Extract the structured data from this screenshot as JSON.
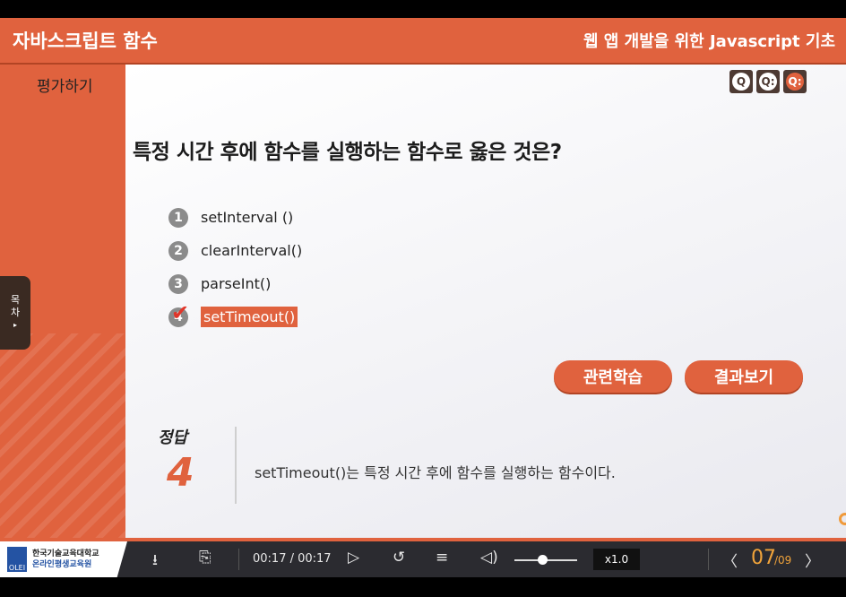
{
  "header": {
    "title": "자바스크립트 함수",
    "subtitle": "웹 앱 개발을 위한 Javascript 기초"
  },
  "sidebar": {
    "section_label": "평가하기",
    "toc_label_1": "목",
    "toc_label_2": "차",
    "toc_arrow": "▸"
  },
  "quiz": {
    "nav_icons": [
      "Q",
      "Q:",
      "Q:"
    ],
    "number": "03",
    "question": "특정 시간 후에 함수를 실행하는 함수로 옳은 것은?",
    "options": [
      {
        "num": "1",
        "label": "setInterval ()"
      },
      {
        "num": "2",
        "label": "clearInterval()"
      },
      {
        "num": "3",
        "label": "parseInt()"
      },
      {
        "num": "4",
        "label": "setTimeout()"
      }
    ],
    "selected_index": 3,
    "related_button": "관련학습",
    "result_button": "결과보기",
    "answer_label": "정답",
    "answer_number": "4",
    "explanation": "setTimeout()는 특정 시간 후에 함수를 실행하는 함수이다."
  },
  "player": {
    "logo_line1": "한국기술교육대학교",
    "logo_line2": "온라인평생교육원",
    "logo_mark": "OLEI",
    "time": "00:17 / 00:17",
    "speed": "x1.0",
    "page_current": "07",
    "page_total": "/09"
  },
  "colors": {
    "accent": "#e0623e",
    "player_bg": "#2b2b30",
    "page_number": "#f0a33a"
  }
}
